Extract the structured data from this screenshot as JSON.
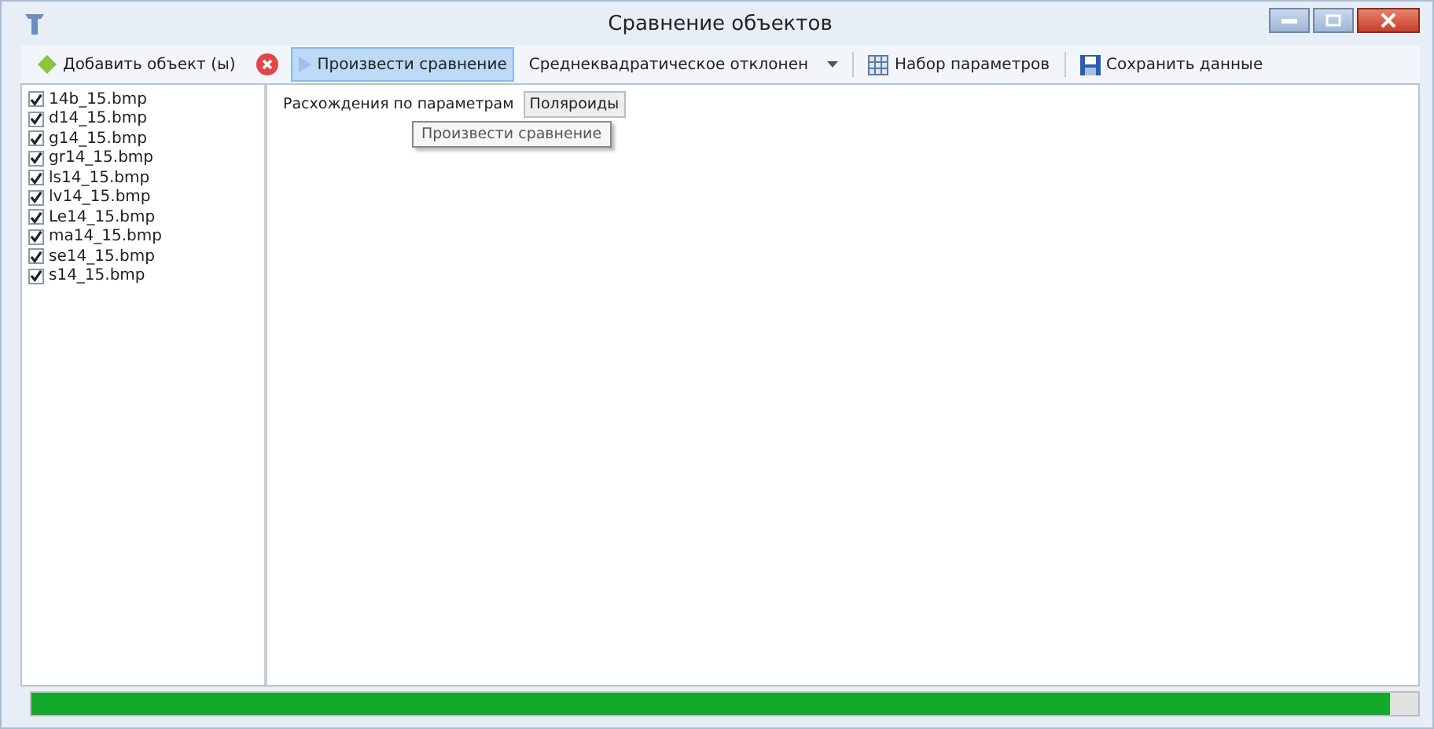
{
  "window": {
    "title": "Сравнение объектов"
  },
  "toolbar": [
    {
      "kind": "button",
      "label": "Добавить объект (ы)",
      "highlighted": false
    },
    {
      "kind": "icon",
      "highlighted": false
    },
    {
      "kind": "button",
      "label": "Произвести сравнение",
      "highlighted": true
    },
    {
      "kind": "dropdown",
      "label": "Среднеквадратическое отклонен"
    },
    {
      "kind": "separator"
    },
    {
      "kind": "button",
      "label": "Набор параметров",
      "highlighted": false
    },
    {
      "kind": "separator"
    },
    {
      "kind": "button",
      "label": "Сохранить данные",
      "highlighted": false
    }
  ],
  "files": [
    {
      "label": "14b_15.bmp",
      "checked": true
    },
    {
      "label": "d14_15.bmp",
      "checked": true
    },
    {
      "label": "g14_15.bmp",
      "checked": true
    },
    {
      "label": "gr14_15.bmp",
      "checked": true
    },
    {
      "label": "ls14_15.bmp",
      "checked": true
    },
    {
      "label": "lv14_15.bmp",
      "checked": true
    },
    {
      "label": "Le14_15.bmp",
      "checked": true
    },
    {
      "label": "ma14_15.bmp",
      "checked": true
    },
    {
      "label": "se14_15.bmp",
      "checked": true
    },
    {
      "label": "s14_15.bmp",
      "checked": true
    }
  ],
  "tabs": [
    {
      "label": "Расхождения по параметрам",
      "selected": true
    },
    {
      "label": "Поляроиды",
      "selected": false
    }
  ],
  "tooltip": "Произвести сравнение",
  "progress": {
    "level": 0.98
  }
}
